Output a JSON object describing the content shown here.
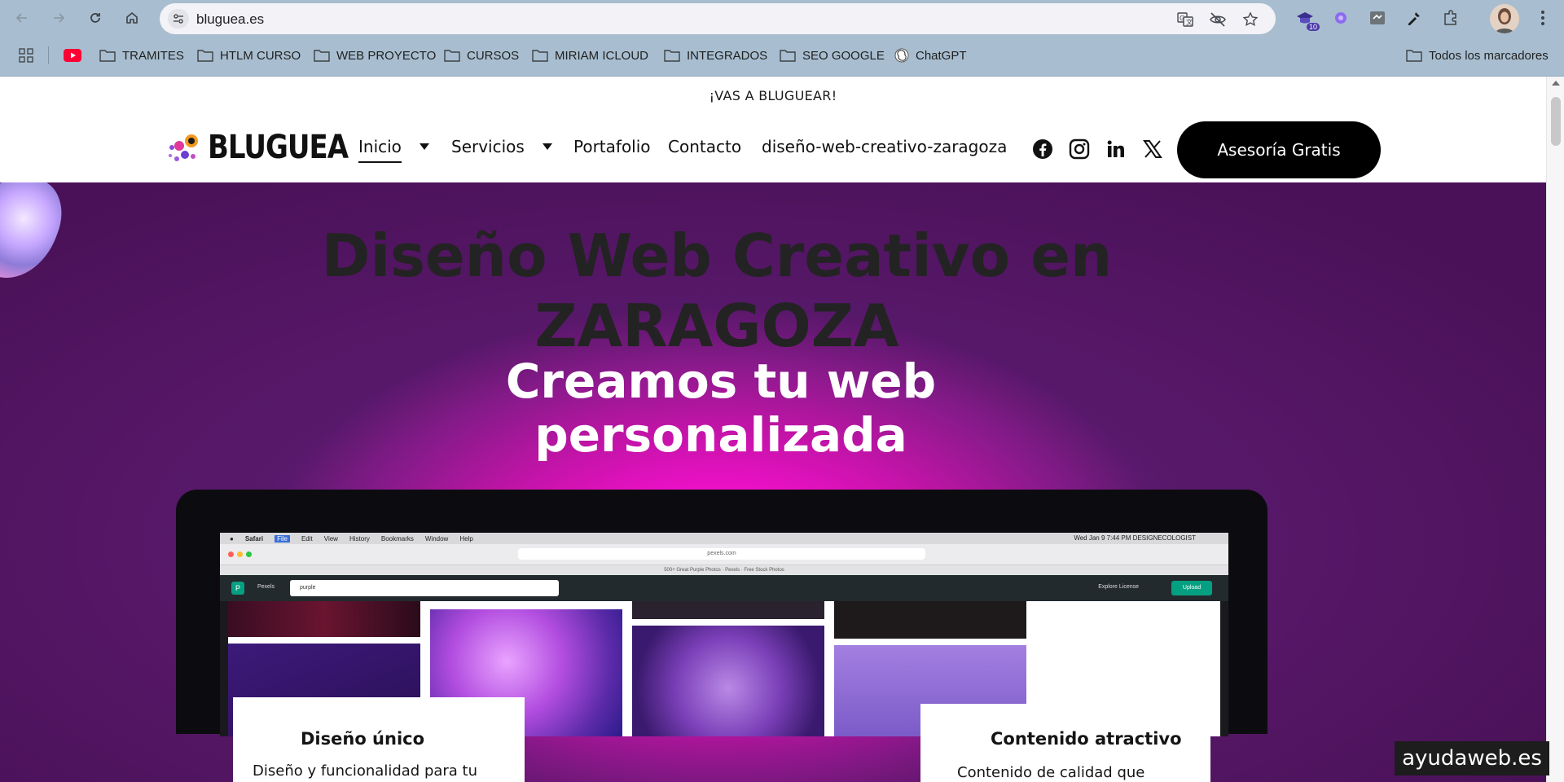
{
  "browser": {
    "url": "bluguea.es",
    "extension_badge": "10",
    "bookmarks": [
      {
        "label": "TRAMITES",
        "icon": "folder-icon"
      },
      {
        "label": "HTLM CURSO",
        "icon": "folder-icon"
      },
      {
        "label": "WEB PROYECTO",
        "icon": "folder-icon"
      },
      {
        "label": "CURSOS",
        "icon": "folder-icon"
      },
      {
        "label": "MIRIAM ICLOUD",
        "icon": "folder-icon"
      },
      {
        "label": "INTEGRADOS",
        "icon": "folder-icon"
      },
      {
        "label": "SEO GOOGLE",
        "icon": "folder-icon"
      },
      {
        "label": "ChatGPT",
        "icon": "chatgpt-icon"
      }
    ],
    "all_bookmarks": "Todos los marcadores"
  },
  "site": {
    "announcement": "¡VAS A BLUGUEAR!",
    "logo_text": "BLUGUEA",
    "nav": [
      {
        "label": "Inicio",
        "has_dropdown": true,
        "active": true
      },
      {
        "label": "Servicios",
        "has_dropdown": true,
        "active": false
      },
      {
        "label": "Portafolio",
        "has_dropdown": false,
        "active": false
      },
      {
        "label": "Contacto",
        "has_dropdown": false,
        "active": false
      },
      {
        "label": "diseño-web-creativo-zaragoza",
        "has_dropdown": false,
        "active": false
      }
    ],
    "social": [
      "facebook-icon",
      "instagram-icon",
      "linkedin-icon",
      "x-icon"
    ],
    "cta_label": "Asesoría Gratis"
  },
  "hero": {
    "title_line1": "Diseño Web Creativo en",
    "title_line2": "ZARAGOZA",
    "subtitle_line1": "Creamos tu web",
    "subtitle_line2": "personalizada"
  },
  "laptop_screen": {
    "menubar_items": [
      "Safari",
      "File",
      "Edit",
      "View",
      "History",
      "Bookmarks",
      "Window",
      "Help"
    ],
    "menubar_right": "Wed Jan 9  7:44 PM   DESIGNECOLOGIST",
    "address": "pexels.com",
    "tab_title": "500+ Great Purple Photos · Pexels · Free Stock Photos",
    "brand": "Pexels",
    "search_value": "purple",
    "links": "Explore     License",
    "upload": "Upload"
  },
  "cards": [
    {
      "title": "Diseño único",
      "text": "Diseño y funcionalidad para tu"
    },
    {
      "title": "Contenido atractivo",
      "text": "Contenido de calidad que"
    }
  ],
  "watermark": "ayudaweb.es",
  "colors": {
    "chrome_bg": "#a8bed0",
    "cta_bg": "#000000",
    "hero_glow": "#ff1ed6",
    "hero_edge": "#5b1a6e"
  }
}
